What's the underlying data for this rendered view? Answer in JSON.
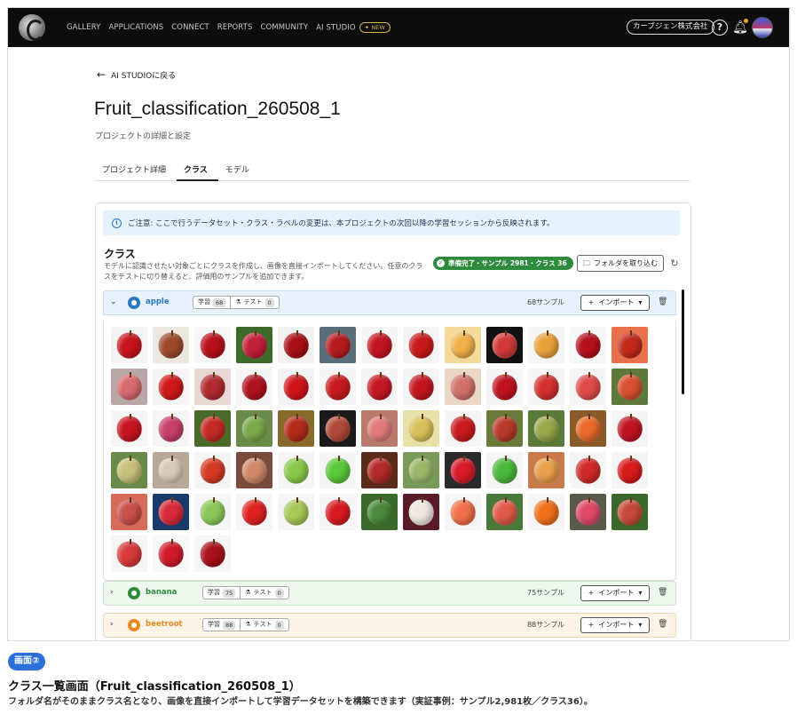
{
  "nav": {
    "links": [
      "GALLERY",
      "APPLICATIONS",
      "CONNECT",
      "REPORTS",
      "COMMUNITY",
      "AI STUDIO"
    ],
    "new_badge": "NEW",
    "company": "カーブジェン株式会社",
    "help_icon": "help-circle-icon",
    "bell_icon": "bell-icon"
  },
  "header": {
    "back_label": "AI STUDIOに戻る",
    "title": "Fruit_classification_260508_1",
    "subtitle": "プロジェクトの詳細と設定"
  },
  "tabs": [
    {
      "label": "プロジェクト詳細",
      "active": false
    },
    {
      "label": "クラス",
      "active": true
    },
    {
      "label": "モデル",
      "active": false
    }
  ],
  "notice": "ご注意: ここで行うデータセット・クラス・ラベルの変更は、本プロジェクトの次回以降の学習セッションから反映されます。",
  "classes_section": {
    "heading": "クラス",
    "description": "モデルに認識させたい対象ごとにクラスを作成し、画像を直接インポートしてください。任意のクラスをテストに切り替えると、評価用のサンプルを追加できます。",
    "ready_badge": "準備完了・サンプル 2981・クラス 36",
    "folder_button": "フォルダを取り込む"
  },
  "class_rows": [
    {
      "name": "apple",
      "train_label": "学習",
      "train_count": "68",
      "test_label": "テスト",
      "test_count": "0",
      "samples": "68サンプル",
      "import_label": "インポート",
      "expanded": true,
      "color": "#2b78c2",
      "bg": "#e6f1fb",
      "border": "#c9dff3"
    },
    {
      "name": "banana",
      "train_label": "学習",
      "train_count": "75",
      "test_label": "テスト",
      "test_count": "0",
      "samples": "75サンプル",
      "import_label": "インポート",
      "expanded": false,
      "color": "#2e8b3d",
      "bg": "#edf7ee",
      "border": "#c8e3cb"
    },
    {
      "name": "beetroot",
      "train_label": "学習",
      "train_count": "88",
      "test_label": "テスト",
      "test_count": "0",
      "samples": "88サンプル",
      "import_label": "インポート",
      "expanded": false,
      "color": "#e7891f",
      "bg": "#fdf3e6",
      "border": "#f1d7b2"
    }
  ],
  "apple_thumbnails": [
    {
      "bg": "#f4f4f4",
      "fruit": "#c8141c"
    },
    {
      "bg": "#ece8e0",
      "fruit": "#9c4a2c"
    },
    {
      "bg": "#f6f6f6",
      "fruit": "#b8101a"
    },
    {
      "bg": "#3f6b2a",
      "fruit": "#c4203a"
    },
    {
      "bg": "#f2f2f2",
      "fruit": "#a80f18"
    },
    {
      "bg": "#5a6e7a",
      "fruit": "#b51c20"
    },
    {
      "bg": "#f5f5f5",
      "fruit": "#c41422"
    },
    {
      "bg": "#f5f5f5",
      "fruit": "#c81a1a"
    },
    {
      "bg": "#f3d99a",
      "fruit": "#f0b04a"
    },
    {
      "bg": "#111111",
      "fruit": "#d23a3a"
    },
    {
      "bg": "#f5f5f5",
      "fruit": "#e8a23a"
    },
    {
      "bg": "#f7f7f7",
      "fruit": "#b5101c"
    },
    {
      "bg": "#e8704a",
      "fruit": "#c42a1c"
    },
    {
      "bg": "#b9a7a8",
      "fruit": "#d86a70"
    },
    {
      "bg": "#f5f5f5",
      "fruit": "#d01818"
    },
    {
      "bg": "#e8d8d4",
      "fruit": "#b02a30"
    },
    {
      "bg": "#f5f5f5",
      "fruit": "#b01220"
    },
    {
      "bg": "#f3f3f3",
      "fruit": "#d0141c"
    },
    {
      "bg": "#f5f5f5",
      "fruit": "#c81a20"
    },
    {
      "bg": "#f5f5f5",
      "fruit": "#c41822"
    },
    {
      "bg": "#f5f5f5",
      "fruit": "#c51620"
    },
    {
      "bg": "#e9d6c4",
      "fruit": "#d2706a"
    },
    {
      "bg": "#f5f5f5",
      "fruit": "#c01220"
    },
    {
      "bg": "#f5f5f5",
      "fruit": "#d43030"
    },
    {
      "bg": "#f5f5f5",
      "fruit": "#e04a4a"
    },
    {
      "bg": "#5c7a3a",
      "fruit": "#d85030"
    },
    {
      "bg": "#f5f5f5",
      "fruit": "#c81420"
    },
    {
      "bg": "#f5f5f5",
      "fruit": "#c8406a"
    },
    {
      "bg": "#4a6a2a",
      "fruit": "#c42a22"
    },
    {
      "bg": "#6a8a4a",
      "fruit": "#7aa84a"
    },
    {
      "bg": "#8a6a2a",
      "fruit": "#b22a1a"
    },
    {
      "bg": "#1a1a1a",
      "fruit": "#b04a3a"
    },
    {
      "bg": "#b87a6a",
      "fruit": "#e07a7a"
    },
    {
      "bg": "#e8e0a8",
      "fruit": "#d8c05a"
    },
    {
      "bg": "#f5f5f5",
      "fruit": "#c81a1c"
    },
    {
      "bg": "#6a7a3a",
      "fruit": "#b83a2a"
    },
    {
      "bg": "#5a7a3a",
      "fruit": "#9aa84a"
    },
    {
      "bg": "#8a5a2a",
      "fruit": "#e86a2a"
    },
    {
      "bg": "#f5f5f5",
      "fruit": "#c01422"
    },
    {
      "bg": "#6a8a4a",
      "fruit": "#c8c07a"
    },
    {
      "bg": "#b8a898",
      "fruit": "#d8c8b8"
    },
    {
      "bg": "#f5f5f5",
      "fruit": "#d43a22"
    },
    {
      "bg": "#7a4a3a",
      "fruit": "#d08a6a"
    },
    {
      "bg": "#f5f5f5",
      "fruit": "#8ac84a"
    },
    {
      "bg": "#f5f5f5",
      "fruit": "#5ac83a"
    },
    {
      "bg": "#5a2a1a",
      "fruit": "#b42a2a"
    },
    {
      "bg": "#7a9a5a",
      "fruit": "#9ab86a"
    },
    {
      "bg": "#2a2a2a",
      "fruit": "#d81a2a"
    },
    {
      "bg": "#f5f5f5",
      "fruit": "#4ab83a"
    },
    {
      "bg": "#c87a4a",
      "fruit": "#e8a04a"
    },
    {
      "bg": "#f5f5f5",
      "fruit": "#d02a2a"
    },
    {
      "bg": "#f5f5f5",
      "fruit": "#d81a1a"
    },
    {
      "bg": "#d86a5a",
      "fruit": "#c8504a"
    },
    {
      "bg": "#1a3a6a",
      "fruit": "#d82a3a"
    },
    {
      "bg": "#f5f5f5",
      "fruit": "#8ac85a"
    },
    {
      "bg": "#f5f5f5",
      "fruit": "#e02020"
    },
    {
      "bg": "#f5f5f5",
      "fruit": "#a8c858"
    },
    {
      "bg": "#f5f5f5",
      "fruit": "#d81a22"
    },
    {
      "bg": "#3a6a2a",
      "fruit": "#4a8a3a"
    },
    {
      "bg": "#5a1a2a",
      "fruit": "#f0e8e0"
    },
    {
      "bg": "#f5f5f5",
      "fruit": "#f0704a"
    },
    {
      "bg": "#4a7a3a",
      "fruit": "#e05a4a"
    },
    {
      "bg": "#f5f5f5",
      "fruit": "#f0701a"
    },
    {
      "bg": "#5a5a4a",
      "fruit": "#e04a6a"
    },
    {
      "bg": "#3a6a2a",
      "fruit": "#c84a3a"
    },
    {
      "bg": "#f5f5f5",
      "fruit": "#d83a3a"
    },
    {
      "bg": "#f8f8f8",
      "fruit": "#d01a2a"
    },
    {
      "bg": "#f5f5f5",
      "fruit": "#a8101c"
    }
  ],
  "caption": {
    "badge": "画面②",
    "title": "クラス一覧画面（Fruit_classification_260508_1）",
    "text": "フォルダ名がそのままクラス名となり、画像を直接インポートして学習データセットを構築できます（実証事例：サンプル2,981枚／クラス36）。"
  }
}
